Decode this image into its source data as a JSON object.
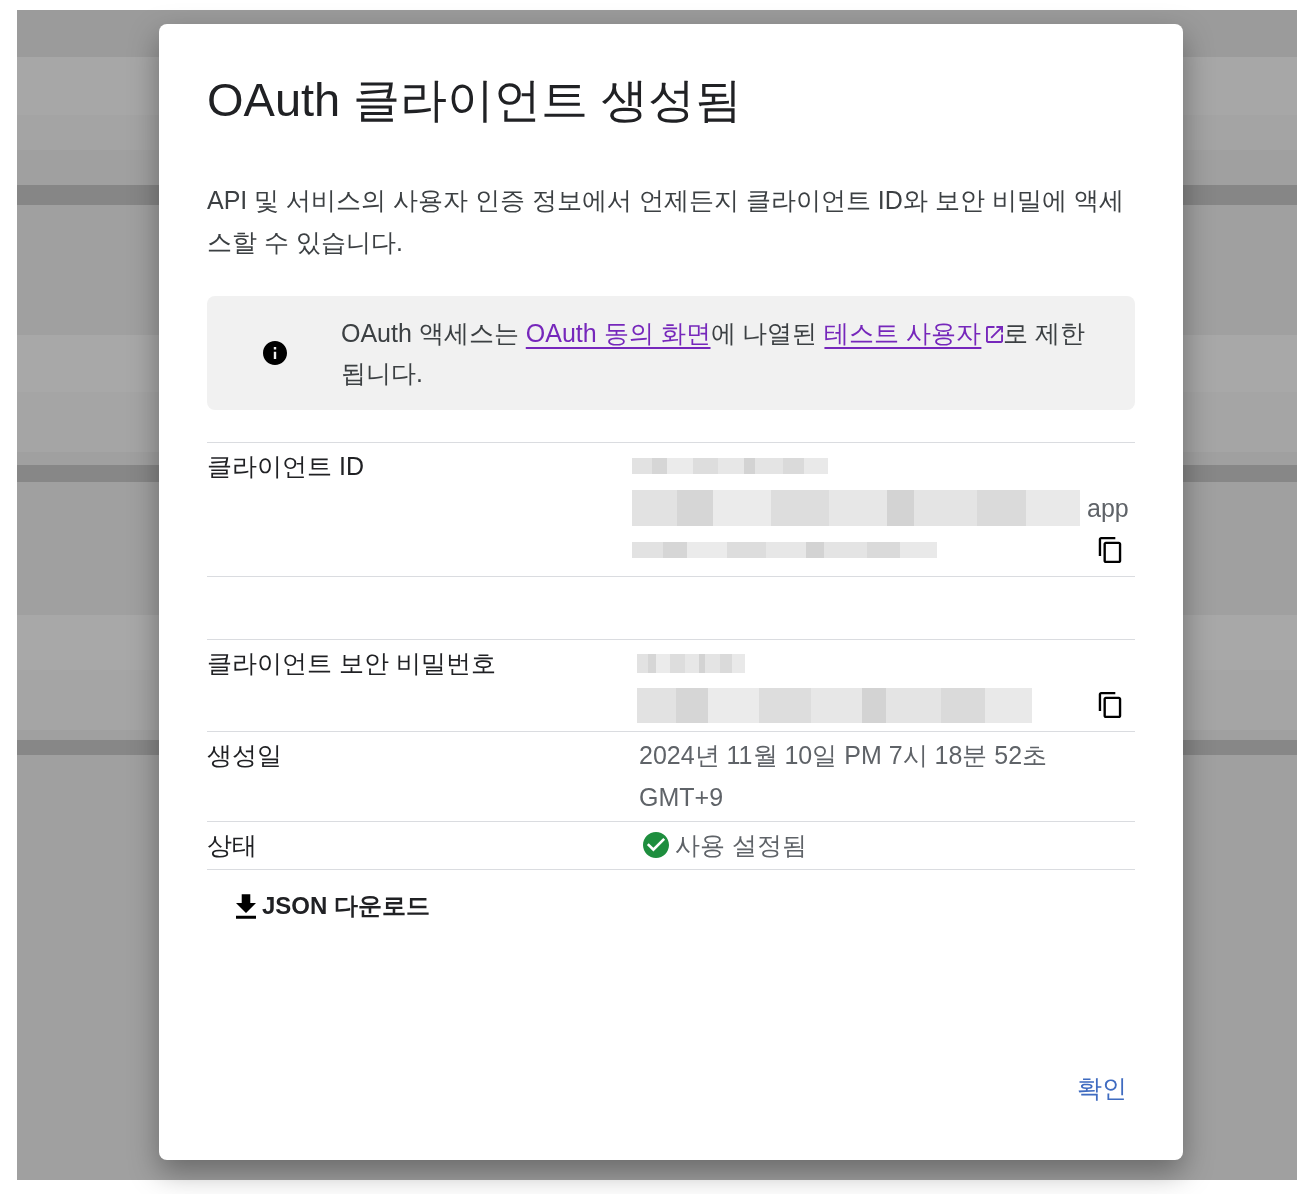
{
  "dialog": {
    "title": "OAuth 클라이언트 생성됨",
    "description": "API 및 서비스의 사용자 인증 정보에서 언제든지 클라이언트 ID와 보안 비밀에 액세스할 수 있습니다.",
    "notice": {
      "parts": [
        {
          "kind": "text",
          "text": "OAuth 액세스는 "
        },
        {
          "kind": "link",
          "text": "OAuth 동의 화면"
        },
        {
          "kind": "text",
          "text": "에 나열된 "
        },
        {
          "kind": "link",
          "text": "테스트 사용자",
          "external": true
        },
        {
          "kind": "text",
          "text": "로 제한됩니다."
        }
      ]
    },
    "sections": [
      {
        "rows": [
          {
            "kind": "secret",
            "label": "클라이언트 ID",
            "value_tail": "app"
          }
        ]
      },
      {
        "rows": [
          {
            "kind": "secret",
            "label": "클라이언트 보안 비밀번호"
          },
          {
            "kind": "text",
            "label": "생성일",
            "value": "2024년 11월 10일 PM 7시 18분 52초 GMT+9"
          },
          {
            "kind": "status",
            "label": "상태",
            "value": "사용 설정됨",
            "enabled": true
          }
        ]
      }
    ],
    "download_button": {
      "label": "JSON 다운로드"
    },
    "actions": [
      {
        "label": "확인"
      }
    ]
  }
}
